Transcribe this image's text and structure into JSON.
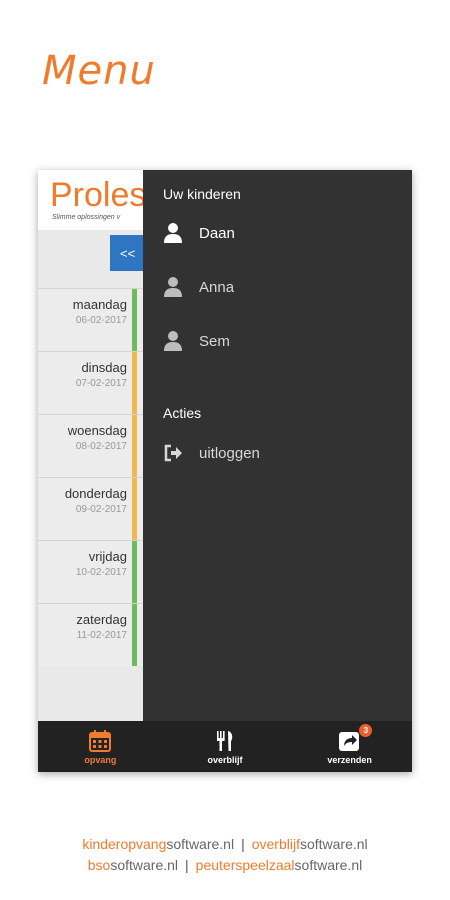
{
  "heading": "Menu",
  "background_app": {
    "logo": "Proles",
    "tagline": "Slimme oplossingen v",
    "back_button": "<<",
    "days": [
      {
        "name": "maandag",
        "date": "06-02-2017",
        "status_color": "#6dbb5c"
      },
      {
        "name": "dinsdag",
        "date": "07-02-2017",
        "status_color": "#f0b850"
      },
      {
        "name": "woensdag",
        "date": "08-02-2017",
        "status_color": "#f0b850"
      },
      {
        "name": "donderdag",
        "date": "09-02-2017",
        "status_color": "#f0b850"
      },
      {
        "name": "vrijdag",
        "date": "10-02-2017",
        "status_color": "#6dbb5c"
      },
      {
        "name": "zaterdag",
        "date": "11-02-2017",
        "status_color": "#6dbb5c"
      }
    ]
  },
  "drawer": {
    "children_title": "Uw kinderen",
    "children": [
      {
        "name": "Daan",
        "icon": "user-icon",
        "active": true
      },
      {
        "name": "Anna",
        "icon": "user-icon",
        "active": false
      },
      {
        "name": "Sem",
        "icon": "user-icon",
        "active": false
      }
    ],
    "actions_title": "Acties",
    "actions": [
      {
        "label": "uitloggen",
        "icon": "sign-out-icon"
      }
    ]
  },
  "bottom_bar": {
    "tabs": [
      {
        "label": "opvang",
        "icon": "calendar-icon",
        "active": true
      },
      {
        "label": "overblijf",
        "icon": "cutlery-icon",
        "active": false
      },
      {
        "label": "verzenden",
        "icon": "share-icon",
        "active": false,
        "badge": "3"
      }
    ]
  },
  "colors": {
    "accent": "#f07b2c",
    "drawer_bg": "#323232",
    "bottom_bar_bg": "#222222",
    "button_blue": "#2f76c2",
    "badge": "#e8612c"
  },
  "footer": {
    "line1": [
      {
        "hl": "kinderopvang",
        "rest": "software.nl"
      },
      {
        "hl": "overblijf",
        "rest": "software.nl"
      }
    ],
    "line2": [
      {
        "hl": "bso",
        "rest": "software.nl"
      },
      {
        "hl": "peuterspeelzaal",
        "rest": "software.nl"
      }
    ],
    "separator": "|"
  }
}
